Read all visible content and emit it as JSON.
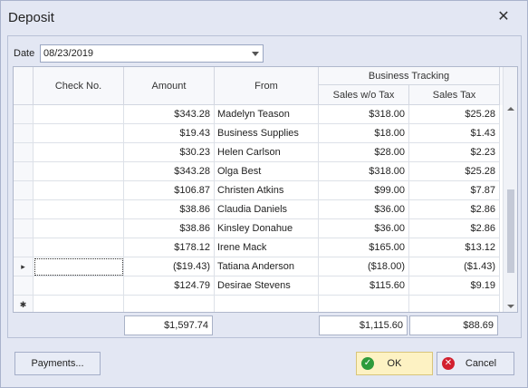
{
  "window": {
    "title": "Deposit"
  },
  "date": {
    "label": "Date",
    "value": "08/23/2019"
  },
  "grid": {
    "columns": {
      "check": "Check No.",
      "amount": "Amount",
      "from": "From",
      "group": "Business Tracking",
      "sales_wo_tax": "Sales w/o Tax",
      "sales_tax": "Sales Tax"
    },
    "rows": [
      {
        "check": "",
        "amount": "$343.28",
        "from": "Madelyn Teason",
        "sales_wo_tax": "$318.00",
        "sales_tax": "$25.28"
      },
      {
        "check": "",
        "amount": "$19.43",
        "from": "Business  Supplies",
        "sales_wo_tax": "$18.00",
        "sales_tax": "$1.43"
      },
      {
        "check": "",
        "amount": "$30.23",
        "from": "Helen Carlson",
        "sales_wo_tax": "$28.00",
        "sales_tax": "$2.23"
      },
      {
        "check": "",
        "amount": "$343.28",
        "from": "Olga Best",
        "sales_wo_tax": "$318.00",
        "sales_tax": "$25.28"
      },
      {
        "check": "",
        "amount": "$106.87",
        "from": "Christen Atkins",
        "sales_wo_tax": "$99.00",
        "sales_tax": "$7.87"
      },
      {
        "check": "",
        "amount": "$38.86",
        "from": "Claudia Daniels",
        "sales_wo_tax": "$36.00",
        "sales_tax": "$2.86"
      },
      {
        "check": "",
        "amount": "$38.86",
        "from": "Kinsley Donahue",
        "sales_wo_tax": "$36.00",
        "sales_tax": "$2.86"
      },
      {
        "check": "",
        "amount": "$178.12",
        "from": "Irene Mack",
        "sales_wo_tax": "$165.00",
        "sales_tax": "$13.12"
      },
      {
        "check": "",
        "amount": "($19.43)",
        "from": "Tatiana Anderson",
        "sales_wo_tax": "($18.00)",
        "sales_tax": "($1.43)"
      },
      {
        "check": "",
        "amount": "$124.79",
        "from": "Desirae Stevens",
        "sales_wo_tax": "$115.60",
        "sales_tax": "$9.19"
      }
    ],
    "current_row_indicator": "▸",
    "new_row_indicator": "✱"
  },
  "totals": {
    "amount": "$1,597.74",
    "sales_wo_tax": "$1,115.60",
    "sales_tax": "$88.69"
  },
  "buttons": {
    "payments": "Payments...",
    "ok": "OK",
    "cancel": "Cancel"
  },
  "icons": {
    "close": "close-icon",
    "ok": "check-circle-icon",
    "cancel": "x-circle-icon"
  },
  "colors": {
    "ok_bg": "#fdf2c3",
    "ok_icon": "#2e9b3b",
    "cancel_icon": "#d2202f"
  }
}
